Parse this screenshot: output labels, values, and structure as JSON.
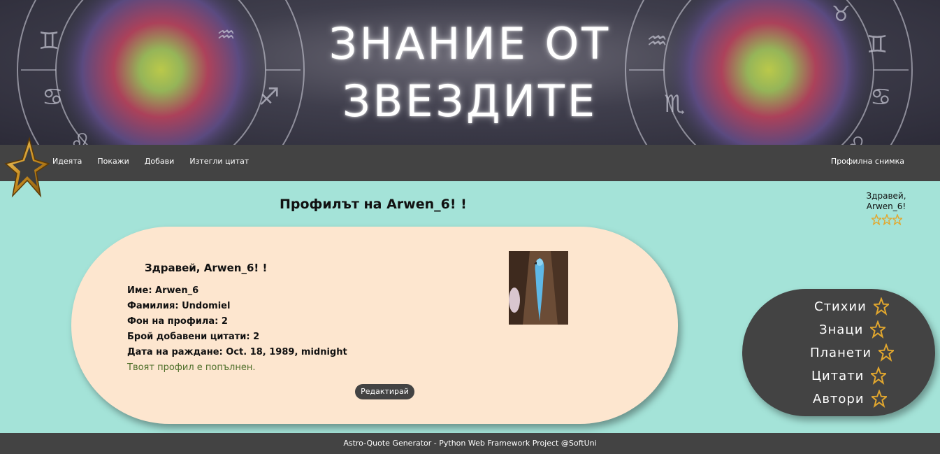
{
  "banner": {
    "title_line1": "ЗНАНИЕ ОТ",
    "title_line2": "ЗВЕЗДИТЕ"
  },
  "nav": {
    "links": [
      "Идеята",
      "Покажи",
      "Добави",
      "Изтегли цитат"
    ],
    "profile_photo": "Профилна снимка"
  },
  "page": {
    "title": "Профилът на Arwen_6! !"
  },
  "greeting": {
    "line1": "Здравей,",
    "line2": "Arwen_6!"
  },
  "profile": {
    "hello": "Здравей, Arwen_6! !",
    "rows": [
      "Име: Arwen_6",
      "Фамилия: Undomiel",
      "Фон на профила: 2",
      "Брой добавени цитати: 2",
      "Дата на раждане: Oct. 18, 1989, midnight"
    ],
    "status": "Твоят профил е попълнен.",
    "edit_label": "Редактирай"
  },
  "side_menu": {
    "items": [
      "Стихии",
      "Знаци",
      "Планети",
      "Цитати",
      "Автори"
    ]
  },
  "footer": {
    "text": "Astro-Quote Generator - Python Web Framework Project @SoftUni"
  },
  "colors": {
    "background": "#a4e3d8",
    "dark": "#434343",
    "card": "#fde6cf",
    "status": "#4e6f2a",
    "star_gold": "#e2a72e"
  }
}
